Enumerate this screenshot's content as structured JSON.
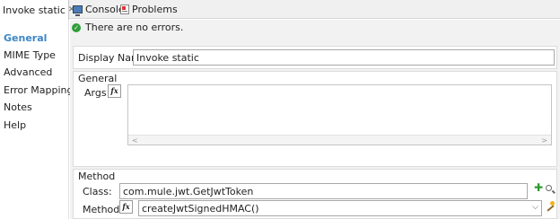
{
  "tabs": {
    "active_label": "Invoke static",
    "close_glyph": "✕",
    "console_label": "Console",
    "problems_label": "Problems"
  },
  "nav": {
    "items": [
      {
        "label": "General",
        "active": true
      },
      {
        "label": "MIME Type",
        "active": false
      },
      {
        "label": "Advanced",
        "active": false
      },
      {
        "label": "Error Mapping",
        "active": false
      },
      {
        "label": "Notes",
        "active": false
      },
      {
        "label": "Help",
        "active": false
      }
    ]
  },
  "status": {
    "text": "There are no errors.",
    "icon": "check-circle-icon",
    "color": "#2e9e3a"
  },
  "display": {
    "label": "Display Name:",
    "value": "Invoke static"
  },
  "general": {
    "title": "General",
    "args_label": "Args:",
    "args_value": "",
    "fx": "fx"
  },
  "method": {
    "title": "Method",
    "class_label": "Class:",
    "class_value": "com.mule.jwt.GetJwtToken",
    "method_label": "Method:",
    "method_value": "createJwtSignedHMAC()",
    "fx": "fx"
  },
  "colors": {
    "accent": "#3d86c6",
    "panel_bg": "#f2f2f2"
  }
}
